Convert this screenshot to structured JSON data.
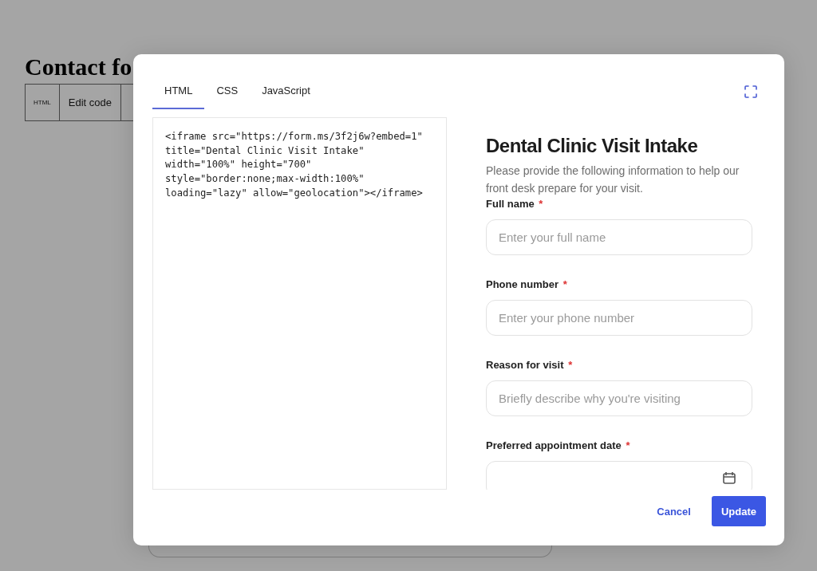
{
  "page": {
    "heading": "Contact fo",
    "toolbar": [
      {
        "label": "HTML",
        "kind": "small"
      },
      {
        "label": "Edit code",
        "kind": "normal"
      }
    ]
  },
  "modal": {
    "tabs": [
      {
        "label": "HTML",
        "selected": true
      },
      {
        "label": "CSS",
        "selected": false
      },
      {
        "label": "JavaScript",
        "selected": false
      }
    ],
    "code_lines": [
      "<iframe src=\"https://form.ms/3f2j6w?embed=1\"",
      "title=\"Dental Clinic Visit Intake\"",
      "width=\"100%\" height=\"700\"",
      "style=\"border:none;max-width:100%\"",
      "loading=\"lazy\" allow=\"geolocation\"></iframe>"
    ],
    "preview": {
      "title": "Dental Clinic Visit Intake",
      "description": "Please provide the following information to help our front desk prepare for your visit.",
      "fields": [
        {
          "label": "Full name",
          "required_mark": "*",
          "kind": "text",
          "placeholder": "Enter your full name"
        },
        {
          "label": "Phone number",
          "required_mark": "*",
          "kind": "text",
          "placeholder": "Enter your phone number"
        },
        {
          "label": "Reason for visit",
          "required_mark": "*",
          "kind": "text",
          "placeholder": "Briefly describe why you're visiting"
        },
        {
          "label": "Preferred appointment date",
          "required_mark": "*",
          "kind": "date"
        }
      ]
    },
    "buttons": [
      {
        "label": "Cancel",
        "kind": "secondary"
      },
      {
        "label": "Update",
        "kind": "primary"
      }
    ]
  }
}
